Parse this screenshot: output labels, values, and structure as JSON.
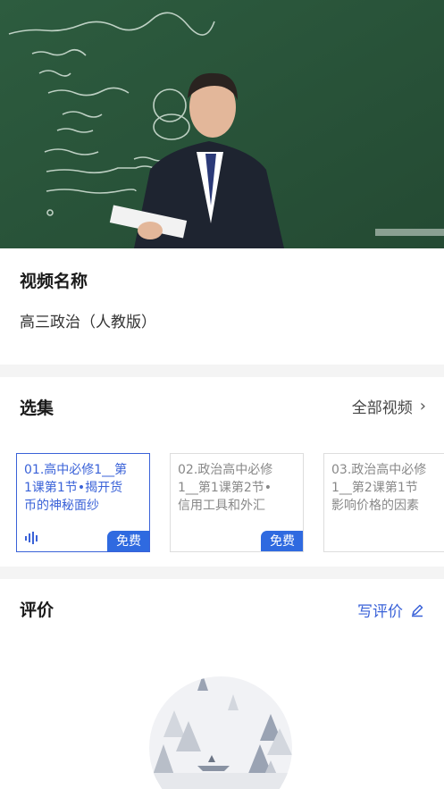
{
  "video": {
    "thumbnail": "teacher-at-chalkboard"
  },
  "info": {
    "title": "视频名称",
    "value": "高三政治（人教版）"
  },
  "episodes": {
    "title": "选集",
    "all_label": "全部视频",
    "items": [
      {
        "lines": [
          "01.高中必修1__第",
          "1课第1节•揭开货",
          "币的神秘面纱"
        ],
        "badge": "免费",
        "active": true
      },
      {
        "lines": [
          "02.政治高中必修",
          "1__第1课第2节•",
          "信用工具和外汇"
        ],
        "badge": "免费",
        "active": false
      },
      {
        "lines": [
          "03.政治高中必修",
          "1__第2课第1节",
          "影响价格的因素"
        ],
        "badge": "",
        "active": false
      }
    ]
  },
  "review": {
    "title": "评价",
    "write_label": "写评价"
  },
  "colors": {
    "accent": "#3a62d8",
    "badge": "#2f6ae0",
    "chalkboard": "#2f5a3c"
  }
}
